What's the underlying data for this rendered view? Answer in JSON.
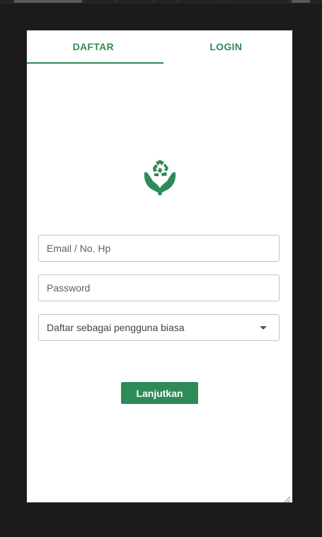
{
  "colors": {
    "accent": "#2e8b57",
    "accent_dark": "#217346",
    "background": "#1b1b1b",
    "card": "#ffffff"
  },
  "tabs": [
    {
      "label": "DAFTAR",
      "active": true
    },
    {
      "label": "LOGIN",
      "active": false
    }
  ],
  "logo": {
    "icon": "recycle-hands-icon"
  },
  "form": {
    "email_placeholder": "Email / No. Hp",
    "password_placeholder": "Password",
    "role_select": "Daftar sebagai pengguna biasa",
    "submit_label": "Lanjutkan"
  }
}
